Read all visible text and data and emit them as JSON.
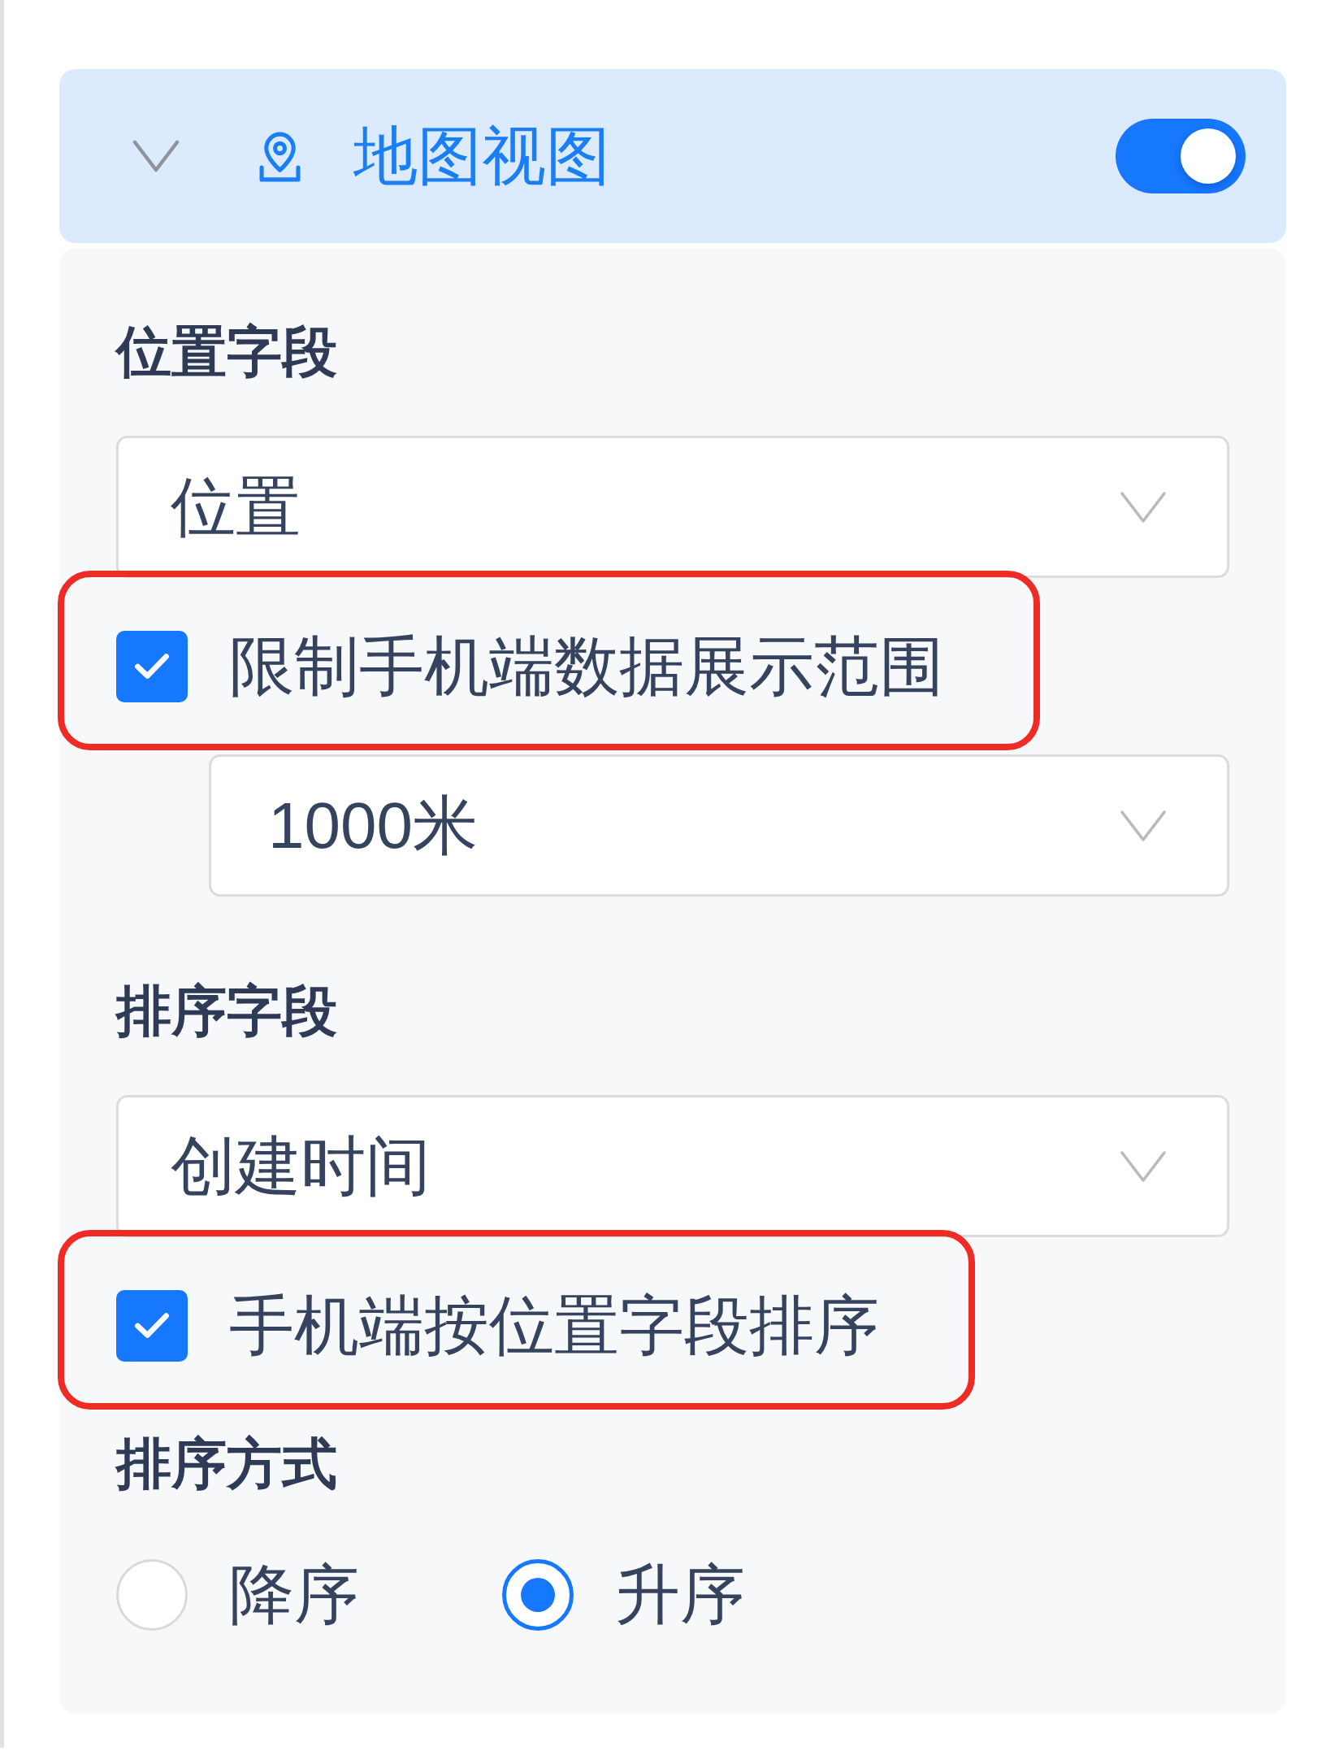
{
  "panel": {
    "title": "地图视图",
    "expanded": true,
    "enabled": true
  },
  "items": [
    {
      "kind": "heading",
      "text": "位置字段"
    },
    {
      "kind": "select",
      "value": "位置"
    },
    {
      "kind": "checkbox",
      "label": "限制手机端数据展示范围",
      "checked": true,
      "highlighted": true,
      "children": [
        {
          "kind": "select",
          "value": "1000米"
        }
      ]
    },
    {
      "kind": "heading",
      "text": "排序字段"
    },
    {
      "kind": "select",
      "value": "创建时间"
    },
    {
      "kind": "checkbox",
      "label": "手机端按位置字段排序",
      "checked": true,
      "highlighted": true
    },
    {
      "kind": "heading",
      "text": "排序方式"
    },
    {
      "kind": "radio_group",
      "options": [
        {
          "label": "降序",
          "selected": false
        },
        {
          "label": "升序",
          "selected": true
        }
      ]
    }
  ]
}
